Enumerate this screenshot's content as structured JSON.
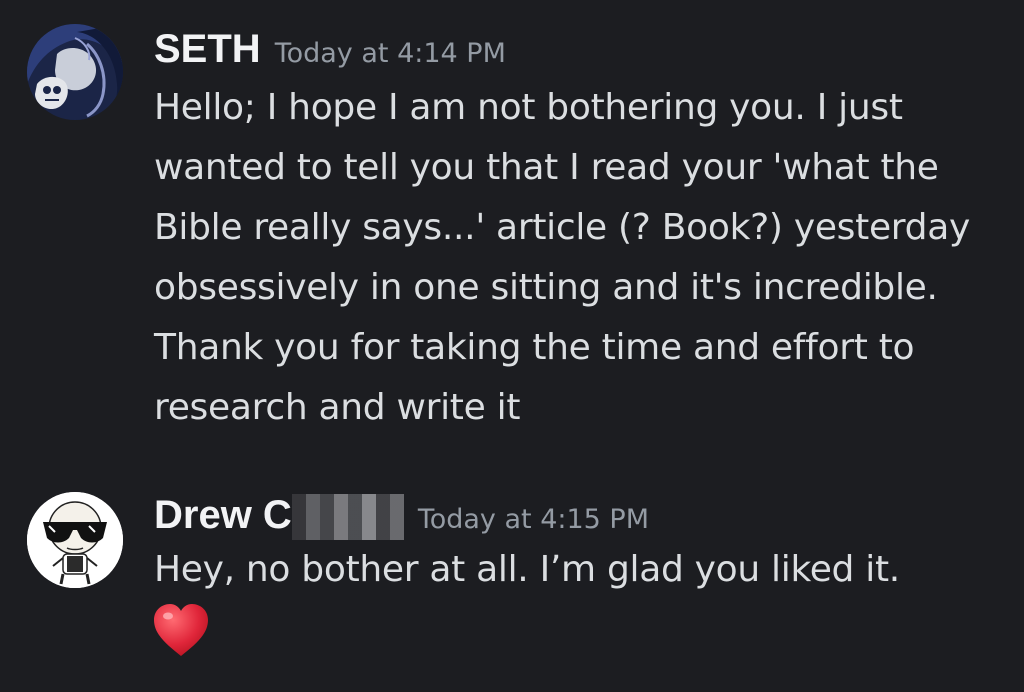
{
  "messages": [
    {
      "username": "SETH",
      "timestamp": "Today at 4:14 PM",
      "text": "Hello; I hope I am not bothering you. I just wanted to tell you that I read your 'what the Bible really says...' article (? Book?) yesterday obsessively in one sitting and it's incredible. Thank you for taking the time and effort to research and write it",
      "avatar_icon": "dark-portrait-avatar"
    },
    {
      "username": "Drew C",
      "timestamp": "Today at 4:15 PM",
      "text": "Hey, no bother at all. I’m glad you liked it.",
      "reaction_icon": "red-heart-emoji",
      "avatar_icon": "cartoon-sunglasses-avatar"
    }
  ],
  "colors": {
    "background": "#1c1d21",
    "username": "#f2f3f5",
    "timestamp": "#949ba4",
    "message_text": "#dbdee1",
    "heart": "#e0263a"
  }
}
